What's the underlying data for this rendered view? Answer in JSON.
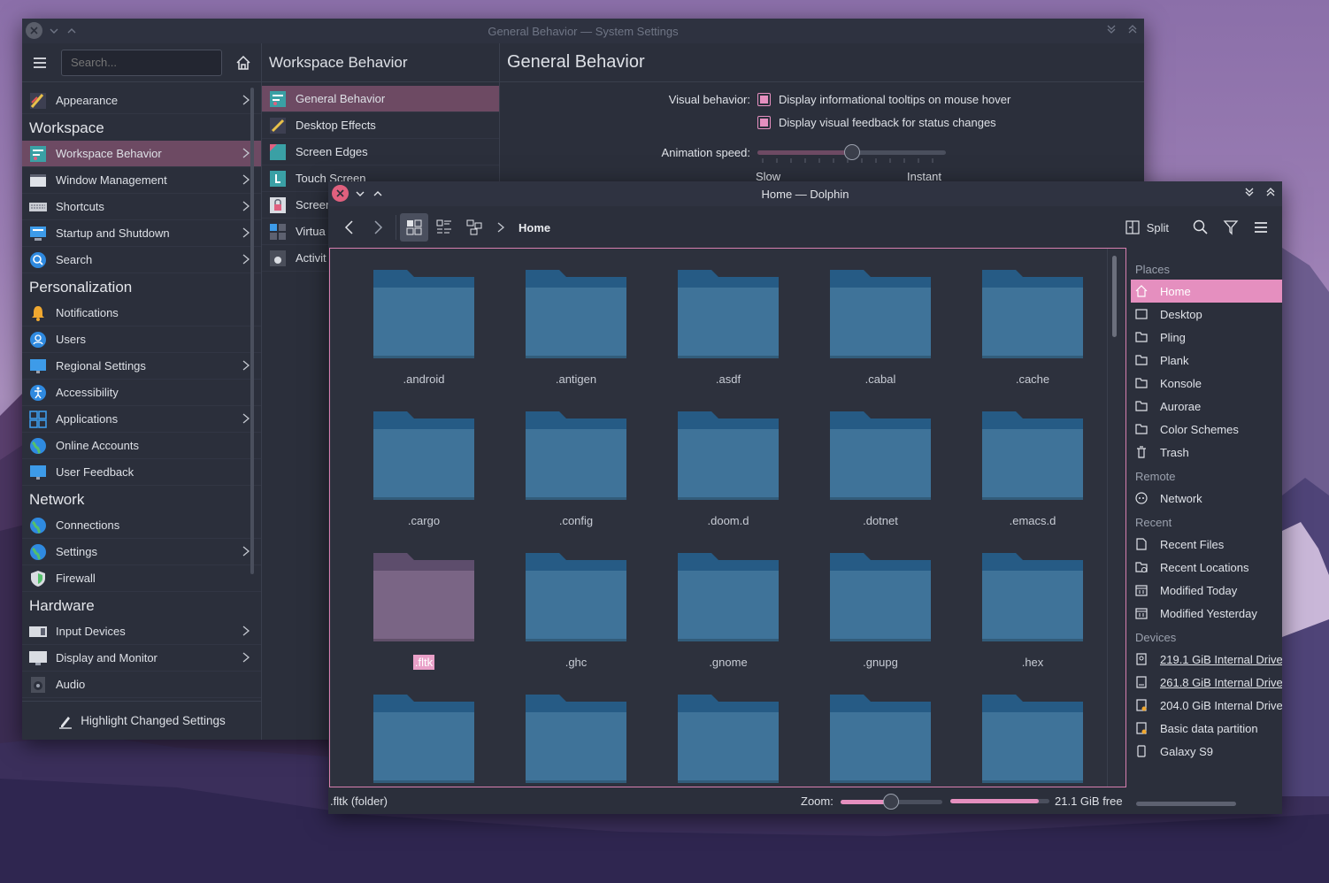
{
  "settings": {
    "title": "General Behavior — System Settings",
    "search_placeholder": "Search...",
    "sidebar": {
      "appearance": "Appearance",
      "cat_workspace": "Workspace",
      "workspace_behavior": "Workspace Behavior",
      "window_management": "Window Management",
      "shortcuts": "Shortcuts",
      "startup": "Startup and Shutdown",
      "search": "Search",
      "cat_personalization": "Personalization",
      "notifications": "Notifications",
      "users": "Users",
      "regional": "Regional Settings",
      "accessibility": "Accessibility",
      "applications": "Applications",
      "online_accounts": "Online Accounts",
      "user_feedback": "User Feedback",
      "cat_network": "Network",
      "connections": "Connections",
      "net_settings": "Settings",
      "firewall": "Firewall",
      "cat_hardware": "Hardware",
      "input_devices": "Input Devices",
      "display": "Display and Monitor",
      "audio": "Audio"
    },
    "highlight_label": "Highlight Changed Settings",
    "sub": {
      "header": "Workspace Behavior",
      "items": [
        "General Behavior",
        "Desktop Effects",
        "Screen Edges",
        "Touch Screen",
        "Screen",
        "Virtua",
        "Activit"
      ]
    },
    "page": {
      "header": "General Behavior",
      "visual_label": "Visual behavior:",
      "tooltip_option": "Display informational tooltips on mouse hover",
      "feedback_option": "Display visual feedback for status changes",
      "anim_label": "Animation speed:",
      "slow": "Slow",
      "instant": "Instant",
      "anim_speed_fraction": 0.5
    }
  },
  "dolphin": {
    "title": "Home — Dolphin",
    "breadcrumb": "Home",
    "split_label": "Split",
    "folders": [
      ".android",
      ".antigen",
      ".asdf",
      ".cabal",
      ".cache",
      ".cargo",
      ".config",
      ".doom.d",
      ".dotnet",
      ".emacs.d",
      ".fltk",
      ".ghc",
      ".gnome",
      ".gnupg",
      ".hex",
      "",
      "",
      "",
      "",
      ""
    ],
    "selected_folder": ".fltk",
    "places": {
      "places_header": "Places",
      "home": "Home",
      "desktop": "Desktop",
      "pling": "Pling",
      "plank": "Plank",
      "konsole": "Konsole",
      "aurorae": "Aurorae",
      "color_schemes": "Color Schemes",
      "trash": "Trash",
      "remote_header": "Remote",
      "network": "Network",
      "recent_header": "Recent",
      "recent_files": "Recent Files",
      "recent_locations": "Recent Locations",
      "modified_today": "Modified Today",
      "modified_yesterday": "Modified Yesterday",
      "devices_header": "Devices",
      "dev1": "219.1 GiB Internal Drive",
      "dev2": "261.8 GiB Internal Drive",
      "dev3": "204.0 GiB Internal Drive",
      "dev4": "Basic data partition",
      "dev5": "Galaxy S9"
    },
    "status_text": ".fltk (folder)",
    "zoom_label": "Zoom:",
    "zoom_fraction": 0.5,
    "free_fraction": 0.89,
    "free_label": "21.1 GiB free"
  },
  "colors": {
    "accent": "#e58fbf",
    "selection_row": "#6d4a63",
    "folder_back": "#265b85",
    "folder_front": "#3f7399",
    "folder_selected": "#7a6585",
    "window_bg": "#2b2f3b"
  }
}
